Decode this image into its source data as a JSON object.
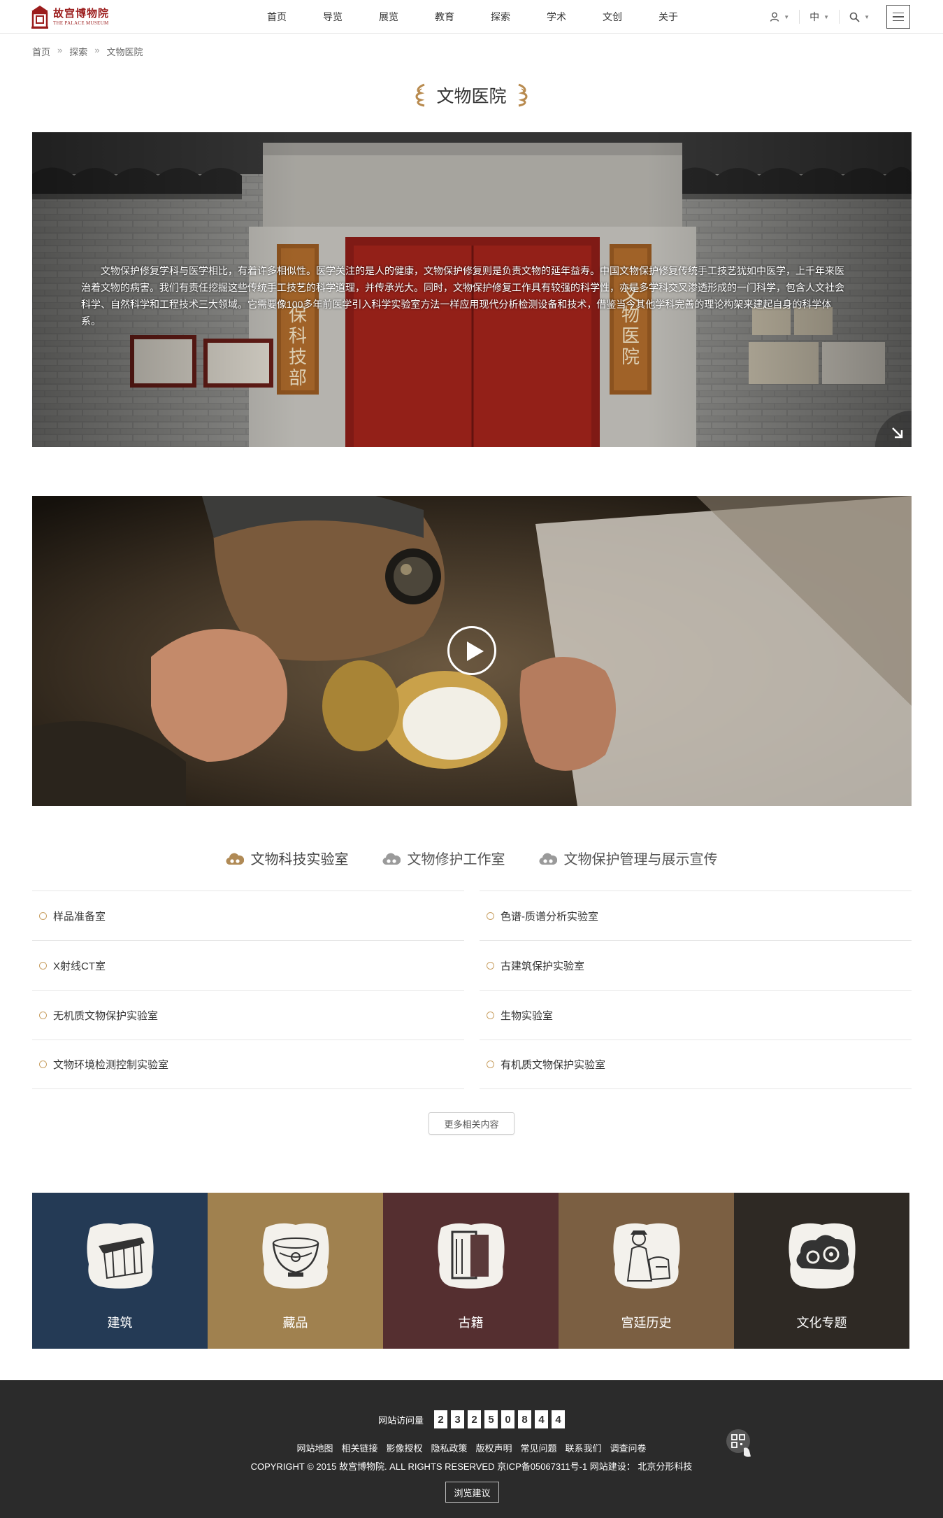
{
  "header": {
    "logo_cn": "故宫博物院",
    "logo_en": "THE PALACE MUSEUM",
    "nav": [
      "首页",
      "导览",
      "展览",
      "教育",
      "探索",
      "学术",
      "文创",
      "关于"
    ],
    "lang": "中"
  },
  "breadcrumb": [
    "首页",
    "探索",
    "文物医院"
  ],
  "page_title": "文物医院",
  "hero": {
    "paragraph": "文物保护修复学科与医学相比，有着许多相似性。医学关注的是人的健康，文物保护修复则是负责文物的延年益寿。中国文物保护修复传统手工技艺犹如中医学，上千年来医治着文物的病害。我们有责任挖掘这些传统手工技艺的科学道理，并传承光大。同时，文物保护修复工作具有较强的科学性，亦是多学科交叉渗透形成的一门科学，包含人文社会科学、自然科学和工程技术三大领域。它需要像100多年前医学引入科学实验室方法一样应用现代分析检测设备和技术，借鉴当今其他学科完善的理论构架来建起自身的科学体系。",
    "plaque_left": "保科技部",
    "plaque_right": "文物医院"
  },
  "tabs": [
    {
      "label": "文物科技实验室",
      "active": true
    },
    {
      "label": "文物修护工作室",
      "active": false
    },
    {
      "label": "文物保护管理与展示宣传",
      "active": false
    }
  ],
  "labs_left": [
    "样品准备室",
    "X射线CT室",
    "无机质文物保护实验室",
    "文物环境检测控制实验室"
  ],
  "labs_right": [
    "色谱-质谱分析实验室",
    "古建筑保护实验室",
    "生物实验室",
    "有机质文物保护实验室"
  ],
  "more_button": "更多相关内容",
  "tiles": [
    {
      "label": "建筑",
      "color": "#243a55"
    },
    {
      "label": "藏品",
      "color": "#a0814f"
    },
    {
      "label": "古籍",
      "color": "#552f30"
    },
    {
      "label": "宫廷历史",
      "color": "#7b5f42"
    },
    {
      "label": "文化专题",
      "color": "#2e2924"
    }
  ],
  "footer": {
    "visits_label": "网站访问量",
    "visits_digits": [
      "2",
      "3",
      "2",
      "5",
      "0",
      "8",
      "4",
      "4"
    ],
    "links": [
      "网站地图",
      "相关链接",
      "影像授权",
      "隐私政策",
      "版权声明",
      "常见问题",
      "联系我们",
      "调查问卷"
    ],
    "copyright": "COPYRIGHT © 2015 故宫博物院. ALL RIGHTS RESERVED  京ICP备05067311号-1    网站建设：  北京分形科技",
    "feedback": "浏览建议"
  },
  "colors": {
    "accent_gold": "#c9a063",
    "logo_red": "#9b1c1c",
    "footer_bg": "#2b2b2b"
  }
}
